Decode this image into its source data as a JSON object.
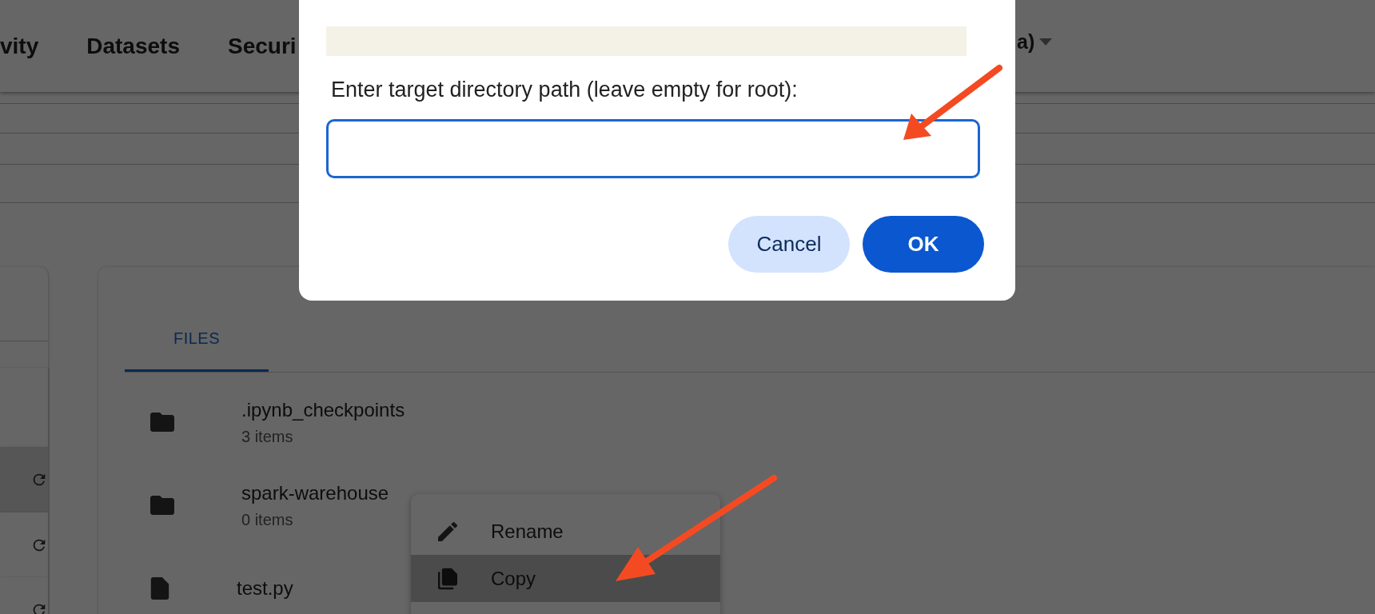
{
  "nav": {
    "items": [
      {
        "label": "vity"
      },
      {
        "label": "Datasets"
      },
      {
        "label": "Securi"
      }
    ],
    "user_menu": {
      "label": "a)"
    }
  },
  "sidebar": {
    "rows": [
      {
        "kind": "blank",
        "selected": false
      },
      {
        "kind": "refresh",
        "selected": true
      },
      {
        "kind": "refresh",
        "selected": false
      },
      {
        "kind": "refresh",
        "selected": false
      }
    ]
  },
  "tabs": [
    {
      "label": "FILES",
      "selected": true
    }
  ],
  "files": [
    {
      "kind": "folder",
      "name": ".ipynb_checkpoints",
      "meta": "3 items"
    },
    {
      "kind": "folder",
      "name": "spark-warehouse",
      "meta": "0 items"
    },
    {
      "kind": "file",
      "name": "test.py"
    }
  ],
  "context_menu": {
    "items": [
      {
        "kind": "rename",
        "label": "Rename",
        "selected": false
      },
      {
        "kind": "copy",
        "label": "Copy",
        "selected": true
      }
    ]
  },
  "dialog": {
    "message": "Enter target directory path (leave empty for root):",
    "input": {
      "focused": true
    },
    "buttons": [
      {
        "kind": "secondary",
        "label": "Cancel"
      },
      {
        "kind": "primary",
        "label": "OK"
      }
    ]
  }
}
